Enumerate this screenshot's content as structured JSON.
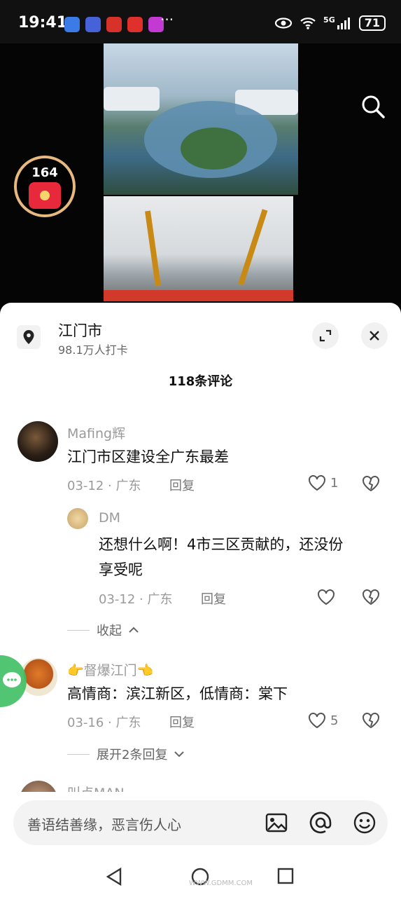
{
  "status_bar": {
    "time": "19:41",
    "more": "···",
    "network": "5G",
    "battery": "71",
    "app_icon_colors": [
      "#3b7be8",
      "#4562d8",
      "#d6322a",
      "#e0302c",
      "#c23ad1"
    ]
  },
  "video": {
    "redpacket_count": "164",
    "search_icon": "search-icon"
  },
  "location": {
    "name": "江门市",
    "checkins": "98.1万人打卡"
  },
  "comments_header": "118条评论",
  "comments": [
    {
      "user": "Mafing辉",
      "text": "江门市区建设全广东最差",
      "date": "03-12 · 广东",
      "reply": "回复",
      "likes": "1"
    },
    {
      "user": "DM",
      "text_line1": "还想什么啊！4市三区贡献的，还没份",
      "text_line2": "享受呢",
      "date": "03-12 · 广东",
      "reply": "回复"
    },
    {
      "user": "👉督爆江门👈",
      "text": "高情商：滨江新区，低情商：棠下",
      "date": "03-16 · 广东",
      "reply": "回复",
      "likes": "5"
    },
    {
      "user": "叫点MAN"
    }
  ],
  "collapse_label": "收起",
  "expand_label": "展开2条回复",
  "input": {
    "placeholder": "善语结善缘，恶言伤人心"
  },
  "watermark": "WWW.GDMM.COM"
}
